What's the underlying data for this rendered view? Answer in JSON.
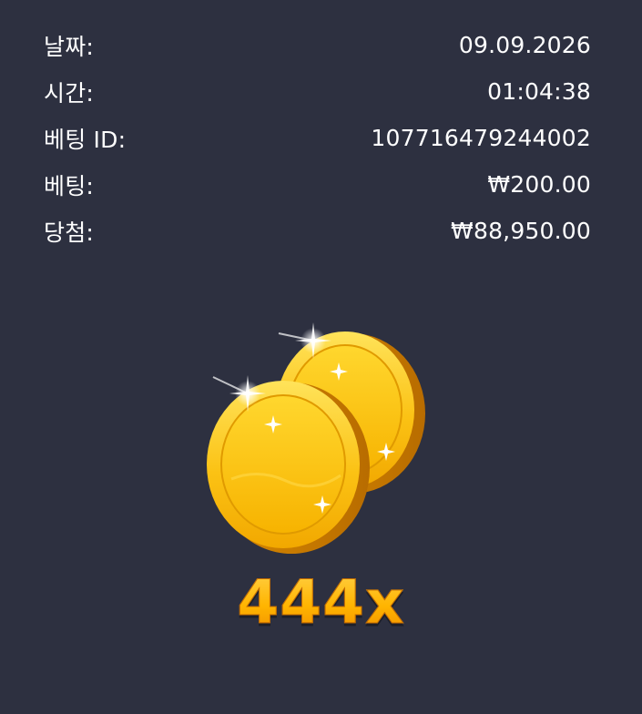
{
  "details": [
    {
      "label": "날짜:",
      "value": "09.09.2026"
    },
    {
      "label": "시간:",
      "value": "01:04:38"
    },
    {
      "label": "베팅 ID:",
      "value": "107716479244002"
    },
    {
      "label": "베팅:",
      "value": "₩200.00"
    },
    {
      "label": "당첨:",
      "value": "₩88,950.00"
    }
  ],
  "win": {
    "multiplier": "444x",
    "icon": "gold-coins-icon"
  },
  "colors": {
    "background": "#2d3040",
    "text": "#ffffff",
    "coin": "#f5b800",
    "multiplier": "#ffb400"
  }
}
